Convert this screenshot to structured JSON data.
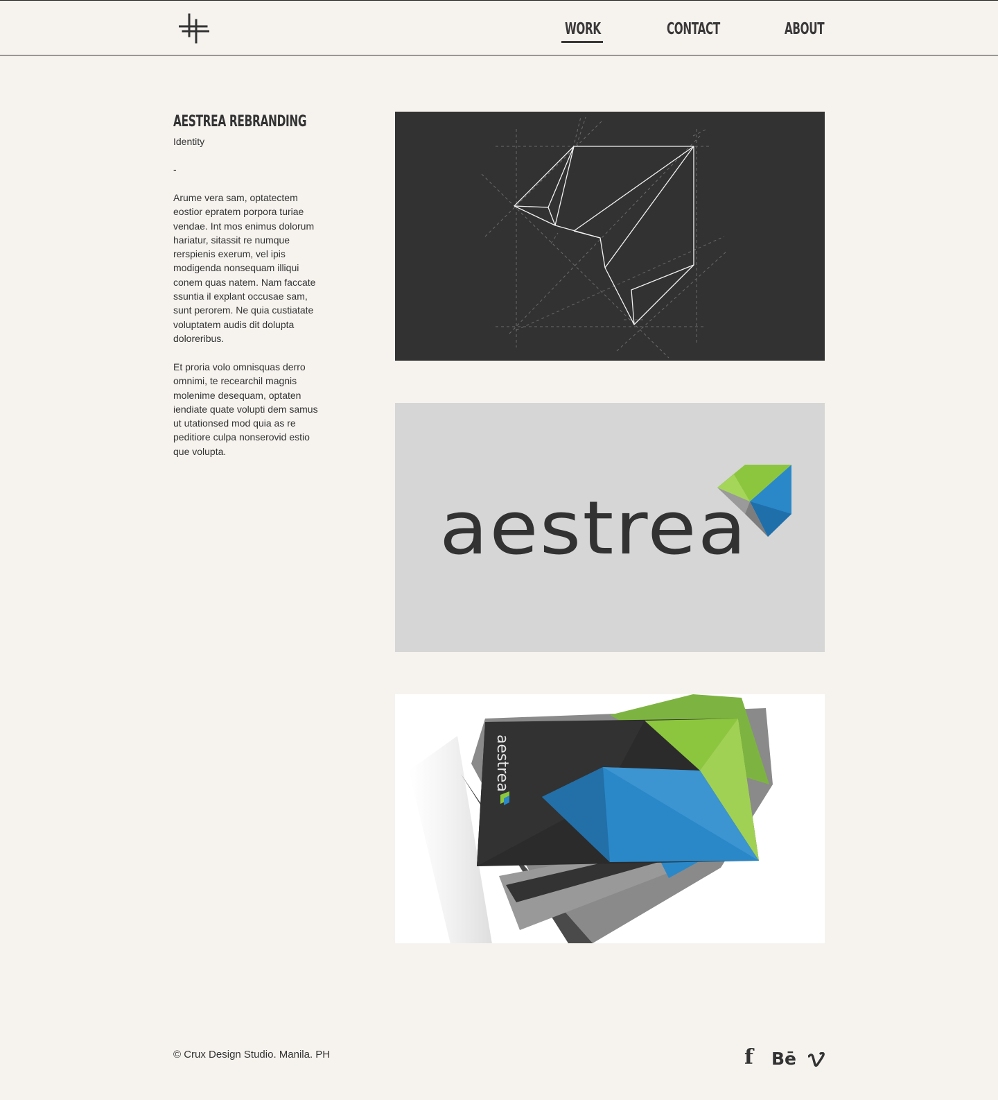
{
  "nav": {
    "items": [
      {
        "label": "WORK",
        "active": true
      },
      {
        "label": "CONTACT",
        "active": false
      },
      {
        "label": "ABOUT",
        "active": false
      }
    ]
  },
  "project": {
    "title": "AESTREA REBRANDING",
    "category": "Identity",
    "divider": "-",
    "paragraphs": [
      "Arume vera sam, optatectem eostior epratem porpora turiae vendae. Int mos enimus dolorum hariatur, sitassit re numque rerspienis exerum, vel ipis modigenda nonsequam illiqui conem quas natem. Nam faccate ssuntia il explant occusae sam, sunt perorem. Ne quia custiatate voluptatem audis dit dolupta doloreribus.",
      "Et proria volo omnisquas derro omnimi, te recearchil magnis molenime desequam, optaten iendiate quate volupti dem samus ut utationsed mod quia as re peditiore culpa nonserovid estio que volupta."
    ],
    "wordmark": "aestrea",
    "card_wordmark": "aestrea"
  },
  "footer": {
    "copyright": "© Crux Design Studio. Manila. PH",
    "social": [
      "facebook-icon",
      "behance-icon",
      "vimeo-icon"
    ],
    "facebook_glyph": "f",
    "behance_glyph": "Bē"
  },
  "colors": {
    "background": "#f6f3ef",
    "text": "#333333",
    "sketch_bg": "#323232",
    "logo_bg": "#d6d6d6",
    "brand_green": "#8cc63f",
    "brand_blue": "#2a88c8"
  }
}
